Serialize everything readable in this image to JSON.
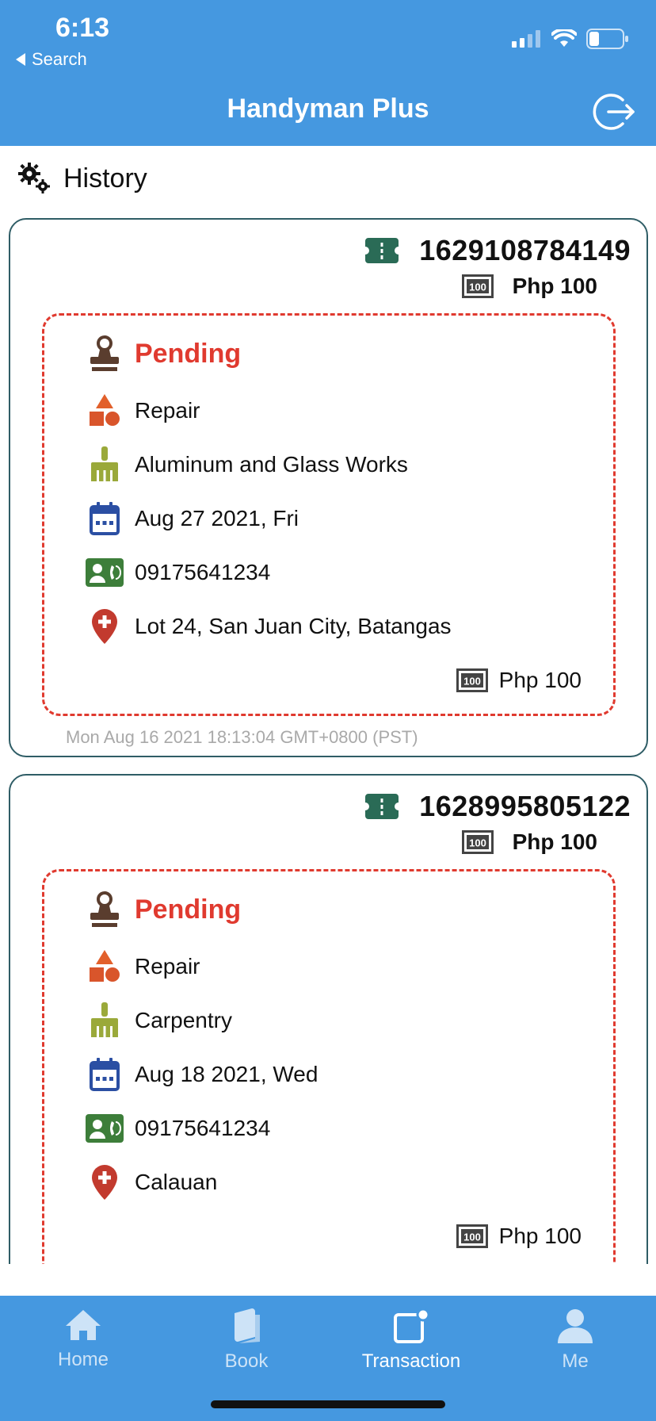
{
  "status_bar": {
    "time": "6:13",
    "back_label": "Search"
  },
  "header": {
    "title": "Handyman Plus"
  },
  "section": {
    "title": "History"
  },
  "transactions": [
    {
      "ticket": "1629108784149",
      "price": "Php 100",
      "status": "Pending",
      "service": "Repair",
      "category": "Aluminum and Glass Works",
      "date": "Aug 27 2021, Fri",
      "phone": "09175641234",
      "address": "Lot 24, San Juan City, Batangas",
      "amount": "Php 100",
      "timestamp": "Mon Aug 16 2021 18:13:04 GMT+0800 (PST)"
    },
    {
      "ticket": "1628995805122",
      "price": "Php 100",
      "status": "Pending",
      "service": "Repair",
      "category": "Carpentry",
      "date": "Aug 18 2021, Wed",
      "phone": "09175641234",
      "address": "Calauan",
      "amount": "Php 100"
    }
  ],
  "tabs": [
    {
      "label": "Home",
      "icon": "home-icon"
    },
    {
      "label": "Book",
      "icon": "book-icon"
    },
    {
      "label": "Transaction",
      "icon": "transaction-icon"
    },
    {
      "label": "Me",
      "icon": "user-icon"
    }
  ],
  "colors": {
    "header_blue": "#4598e0",
    "pending_red": "#e03a2f",
    "card_border": "#2f5d66",
    "ticket_green": "#2a6b56"
  }
}
